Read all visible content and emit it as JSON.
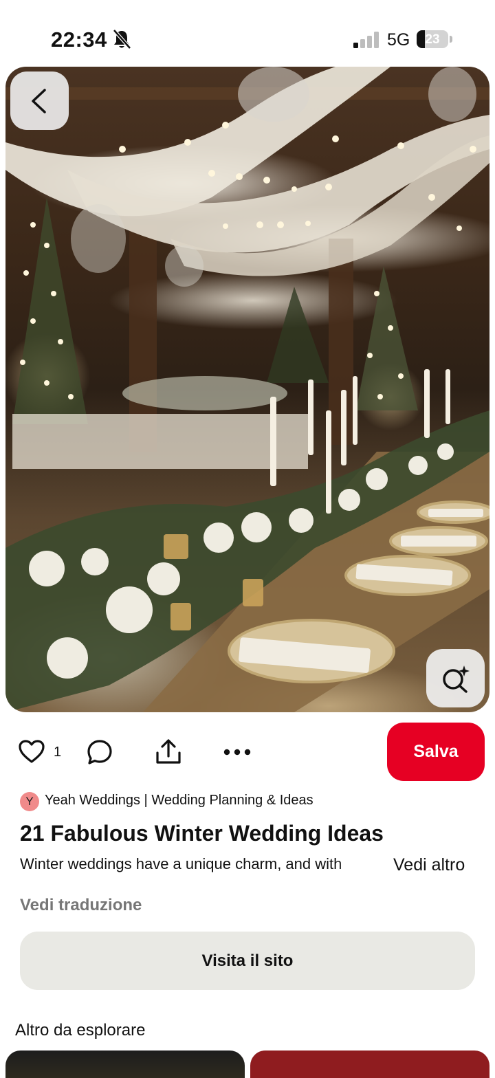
{
  "status_bar": {
    "time": "22:34",
    "network": "5G",
    "battery": "23"
  },
  "pin": {
    "like_count": "1",
    "save_label": "Salva",
    "author_initial": "Y",
    "author_name": "Yeah Weddings | Wedding Planning & Ideas",
    "title": "21 Fabulous Winter Wedding Ideas",
    "description": "Winter weddings have a unique charm, and with",
    "see_more_label": "Vedi altro",
    "translate_label": "Vedi traduzione",
    "visit_label": "Visita il sito"
  },
  "explore": {
    "title": "Altro da esplorare"
  },
  "colors": {
    "save_button": "#e60023",
    "visit_button": "#e9e9e4",
    "avatar": "#f08a8a"
  },
  "icons": [
    "bell-off-icon",
    "signal-icon",
    "battery-icon",
    "back-chevron-icon",
    "visual-search-icon",
    "heart-icon",
    "comment-icon",
    "share-icon",
    "more-icon"
  ]
}
